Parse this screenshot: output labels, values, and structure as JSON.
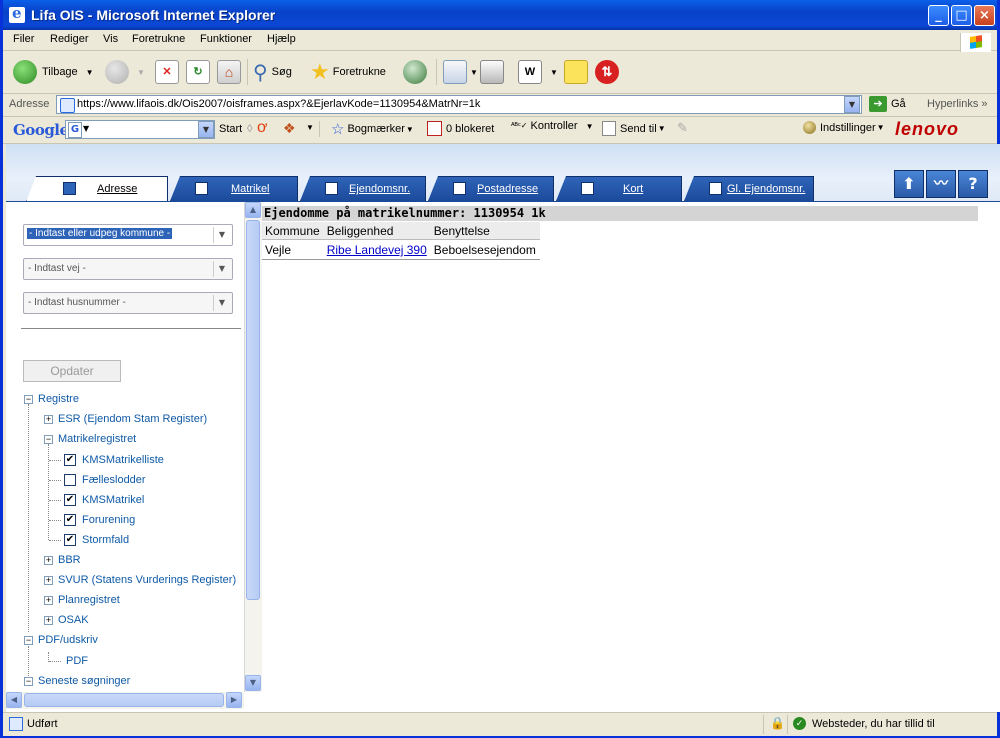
{
  "window": {
    "title": "Lifa OIS - Microsoft Internet Explorer"
  },
  "menu": [
    "Filer",
    "Rediger",
    "Vis",
    "Foretrukne",
    "Funktioner",
    "Hjælp"
  ],
  "toolbar": {
    "back": "Tilbage",
    "search": "Søg",
    "favorites": "Foretrukne"
  },
  "address": {
    "label": "Adresse",
    "url": "https://www.lifaois.dk/Ois2007/oisframes.aspx?&EjerlavKode=1130954&MatrNr=1k",
    "go": "Gå",
    "links": "Hyperlinks"
  },
  "google": {
    "logo": "Google",
    "start": "Start",
    "bookmarks": "Bogmærker",
    "blocked": "0 blokeret",
    "check": "Kontroller",
    "send": "Send til",
    "settings": "Indstillinger",
    "brand": "lenovo"
  },
  "tabs": [
    {
      "label": "Adresse",
      "active": true
    },
    {
      "label": "Matrikel",
      "active": false
    },
    {
      "label": "Ejendomsnr.",
      "active": false
    },
    {
      "label": "Postadresse",
      "active": false
    },
    {
      "label": "Kort",
      "active": false
    },
    {
      "label": "Gl. Ejendomsnr.",
      "active": false
    }
  ],
  "search": {
    "kommune": "- Indtast eller udpeg kommune -",
    "vej": "- Indtast vej -",
    "husnummer": "- Indtast husnummer -",
    "update": "Opdater"
  },
  "tree": {
    "registre": "Registre",
    "esr": "ESR (Ejendom Stam Register)",
    "matrikelregistret": "Matrikelregistret",
    "kmsmatrikelliste": "KMSMatrikelliste",
    "faelleslodder": "Fælleslodder",
    "kmsmatrikel": "KMSMatrikel",
    "forurening": "Forurening",
    "stormfald": "Stormfald",
    "bbr": "BBR",
    "svur": "SVUR (Statens Vurderings Register)",
    "planregistret": "Planregistret",
    "osak": "OSAK",
    "pdf_udskriv": "PDF/udskriv",
    "pdf": "PDF",
    "seneste": "Seneste søgninger"
  },
  "result": {
    "heading": "Ejendomme på matrikelnummer:  1130954  1k",
    "columns": [
      "Kommune",
      "Beliggenhed",
      "Benyttelse"
    ],
    "rows": [
      [
        "Vejle",
        "Ribe Landevej 390",
        "Beboelsesejendom"
      ]
    ]
  },
  "status": {
    "left": "Udført",
    "zone": "Websteder, du har tillid til"
  }
}
